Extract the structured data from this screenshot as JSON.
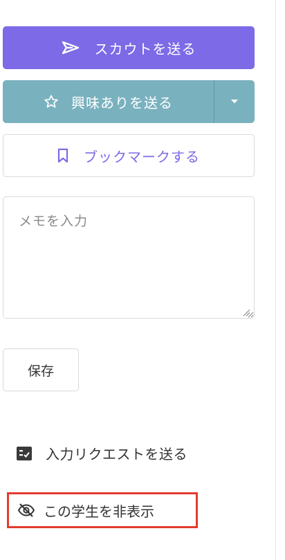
{
  "actions": {
    "scout_label": "スカウトを送る",
    "interest_label": "興味ありを送る",
    "bookmark_label": "ブックマークする"
  },
  "memo": {
    "placeholder": "メモを入力",
    "save_label": "保存"
  },
  "links": {
    "request_label": "入力リクエストを送る",
    "hide_label": "この学生を非表示"
  },
  "icons": {
    "scout": "send-icon",
    "interest": "star-outline-icon",
    "dropdown": "caret-down-icon",
    "bookmark": "bookmark-icon",
    "request": "checklist-icon",
    "hide": "eye-slash-icon"
  },
  "colors": {
    "scout_bg": "#7c6ae6",
    "interest_bg": "#79b1bf",
    "bookmark_text": "#7c6ae6",
    "highlight_border": "#e23b2e"
  }
}
